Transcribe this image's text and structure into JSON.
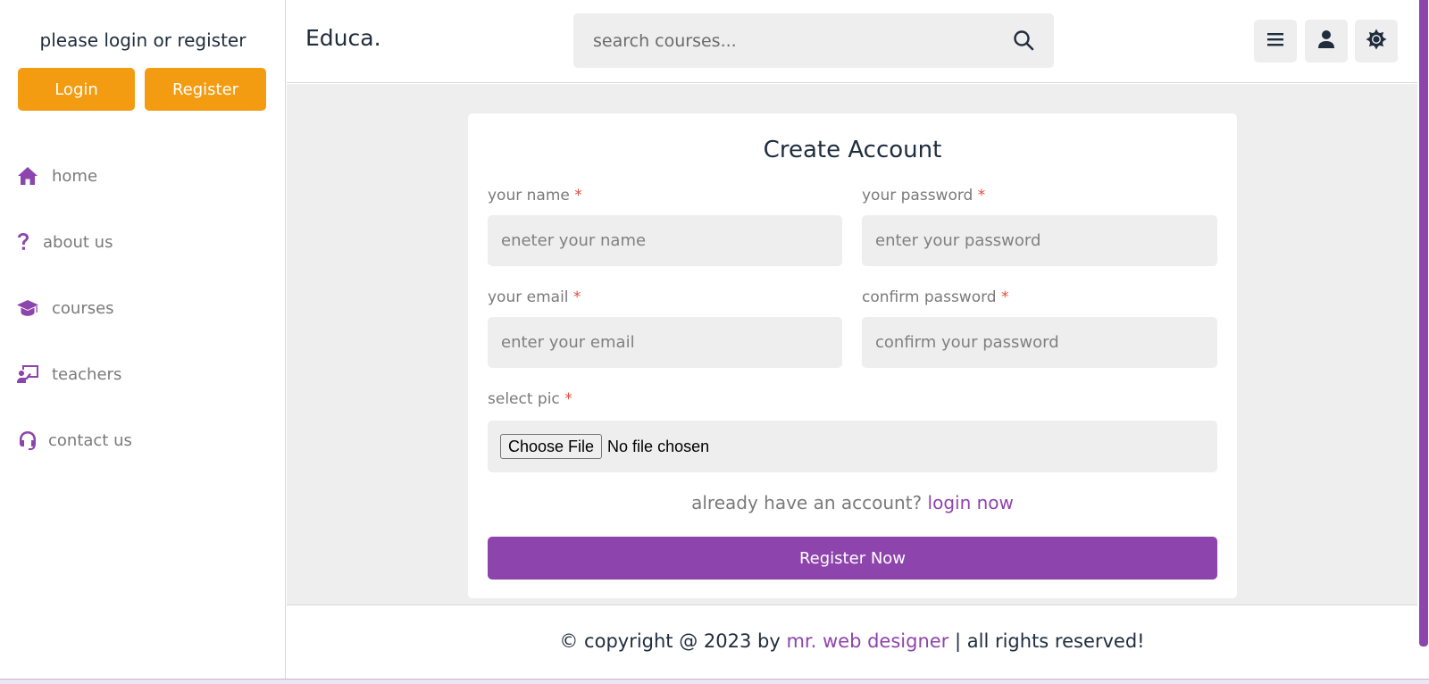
{
  "sidebar": {
    "login_prompt": "please login or register",
    "login_label": "Login",
    "register_label": "Register",
    "items": [
      {
        "label": "home",
        "icon": "home-icon"
      },
      {
        "label": "about us",
        "icon": "question-icon"
      },
      {
        "label": "courses",
        "icon": "graduation-cap-icon"
      },
      {
        "label": "teachers",
        "icon": "chalkboard-teacher-icon"
      },
      {
        "label": "contact us",
        "icon": "headset-icon"
      }
    ]
  },
  "header": {
    "logo": "Educa.",
    "search_placeholder": "search courses..."
  },
  "form": {
    "title": "Create Account",
    "name_label": "your name",
    "name_placeholder": "eneter your name",
    "password_label": "your password",
    "password_placeholder": "enter your password",
    "email_label": "your email",
    "email_placeholder": "enter your email",
    "confirm_label": "confirm password",
    "confirm_placeholder": "confirm your password",
    "pic_label": "select pic",
    "required_mark": "*",
    "file_button": "Choose File",
    "file_status": "No file chosen",
    "already_text": "already have an account?",
    "login_link": "login now",
    "submit_label": "Register Now"
  },
  "footer": {
    "prefix": "© copyright @ 2023 by",
    "author": "mr. web designer",
    "suffix": "| all rights reserved!"
  },
  "colors": {
    "accent": "#8e44ad",
    "orange": "#f39c12",
    "background": "#eeeeee",
    "required": "#e74c3c"
  }
}
